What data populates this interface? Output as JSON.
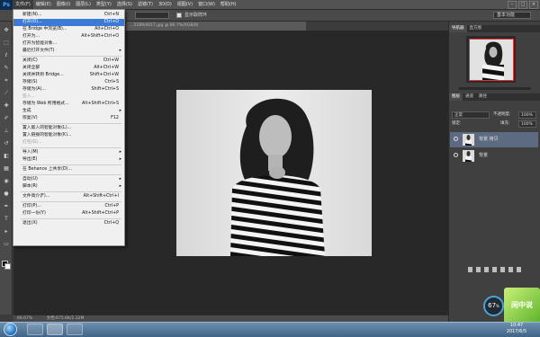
{
  "app": {
    "logo": "Ps",
    "brand_color": "#31a8ff"
  },
  "menubar": {
    "items": [
      "文件(F)",
      "编辑(E)",
      "图像(I)",
      "图层(L)",
      "类型(Y)",
      "选择(S)",
      "滤镜(T)",
      "3D(D)",
      "视图(V)",
      "窗口(W)",
      "帮助(H)"
    ],
    "active_index": 0,
    "window_controls": [
      "–",
      "□",
      "×"
    ]
  },
  "options": {
    "checkbox_label": "显示取样环",
    "right_dropdown": "基本功能"
  },
  "document": {
    "tab_title": "…5189/4017.jpg @ 66.7%(RGB/8)"
  },
  "status": {
    "zoom": "66.67%",
    "doc_size": "文档:675.6K/1.32M"
  },
  "file_menu": {
    "items": [
      {
        "label": "新建(N)...",
        "shortcut": "Ctrl+N",
        "y": 0
      },
      {
        "label": "打开(O)...",
        "shortcut": "Ctrl+O",
        "highlight": true
      },
      {
        "label": "在 Bridge 中浏览(B)...",
        "shortcut": "Alt+Ctrl+O"
      },
      {
        "label": "打开为...",
        "shortcut": "Alt+Shift+Ctrl+O"
      },
      {
        "label": "打开为智能对象..."
      },
      {
        "label": "最近打开文件(T)",
        "submenu": true
      },
      {
        "separator": true
      },
      {
        "label": "关闭(C)",
        "shortcut": "Ctrl+W"
      },
      {
        "label": "关闭全部",
        "shortcut": "Alt+Ctrl+W"
      },
      {
        "label": "关闭并转到 Bridge...",
        "shortcut": "Shift+Ctrl+W"
      },
      {
        "label": "存储(S)",
        "shortcut": "Ctrl+S"
      },
      {
        "label": "存储为(A)...",
        "shortcut": "Shift+Ctrl+S"
      },
      {
        "label": "签入...",
        "disabled": true
      },
      {
        "label": "存储为 Web 所用格式...",
        "shortcut": "Alt+Shift+Ctrl+S"
      },
      {
        "label": "生成",
        "submenu": true
      },
      {
        "label": "恢复(V)",
        "shortcut": "F12"
      },
      {
        "separator": true
      },
      {
        "label": "置入嵌入的智能对象(L)..."
      },
      {
        "label": "置入链接的智能对象(K)..."
      },
      {
        "label": "打包(G)...",
        "disabled": true
      },
      {
        "separator": true
      },
      {
        "label": "导入(M)",
        "submenu": true
      },
      {
        "label": "导出(E)",
        "submenu": true
      },
      {
        "separator": true
      },
      {
        "label": "在 Behance 上共享(D)..."
      },
      {
        "separator": true
      },
      {
        "label": "自动(U)",
        "submenu": true
      },
      {
        "label": "脚本(R)",
        "submenu": true
      },
      {
        "separator": true
      },
      {
        "label": "文件简介(F)...",
        "shortcut": "Alt+Shift+Ctrl+I"
      },
      {
        "separator": true
      },
      {
        "label": "打印(P)...",
        "shortcut": "Ctrl+P"
      },
      {
        "label": "打印一份(Y)",
        "shortcut": "Alt+Shift+Ctrl+P"
      },
      {
        "separator": true
      },
      {
        "label": "退出(X)",
        "shortcut": "Ctrl+Q"
      }
    ]
  },
  "panels": {
    "navigator_tabs": [
      "导航器",
      "直方图"
    ],
    "layers_tabs": [
      "图层",
      "通道",
      "路径"
    ],
    "blend_mode": "正常",
    "opacity_label": "不透明度:",
    "opacity_value": "100%",
    "lock_label": "锁定:",
    "fill_label": "填充:",
    "fill_value": "100%",
    "layers": [
      {
        "name": "背景 拷贝",
        "active": true
      },
      {
        "name": "背景",
        "active": false
      }
    ]
  },
  "widgets": {
    "gauge_value": "67",
    "gauge_unit": "%",
    "green_label": "闲中说"
  },
  "taskbar": {
    "time": "10:47",
    "date": "2017/6/5"
  }
}
